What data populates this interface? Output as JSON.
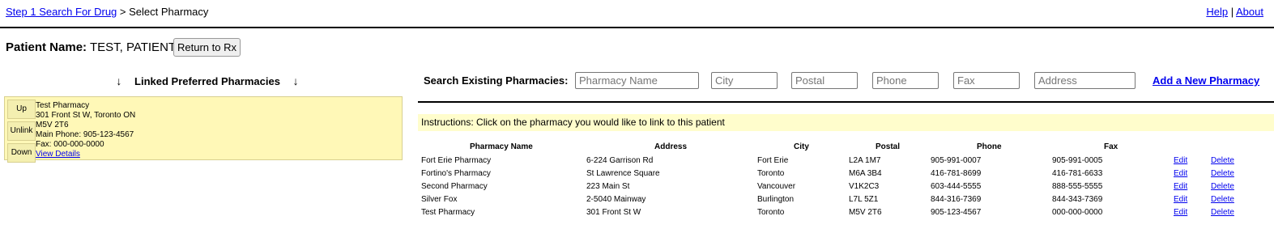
{
  "breadcrumb": {
    "step1_link": "Step 1 Search For Drug",
    "separator": ">",
    "current": "Select Pharmacy"
  },
  "help": {
    "help_link": "Help",
    "separator": "|",
    "about_link": "About"
  },
  "patient": {
    "label": "Patient Name:",
    "name": "TEST, PATIENT",
    "return_button": "Return to Rx"
  },
  "linked": {
    "title": "Linked Preferred Pharmacies",
    "arrow": "↓",
    "card": {
      "buttons": [
        "Up",
        "Unlink",
        "Down"
      ],
      "name": "Test Pharmacy",
      "address": "301 Front St W, Toronto ON",
      "postal": "M5V 2T6",
      "main_phone": "Main Phone: 905-123-4567",
      "fax": "Fax: 000-000-0000",
      "details_link": "View Details"
    }
  },
  "search": {
    "label": "Search Existing Pharmacies:",
    "placeholders": [
      "Pharmacy Name",
      "City",
      "Postal",
      "Phone",
      "Fax",
      "Address"
    ],
    "add_link": "Add a New Pharmacy"
  },
  "instructions": "Instructions: Click on the pharmacy you would like to link to this patient",
  "table": {
    "headers": [
      "Pharmacy Name",
      "Address",
      "City",
      "Postal",
      "Phone",
      "Fax"
    ],
    "rows": [
      [
        "Fort Erie Pharmacy",
        "6-224 Garrison Rd",
        "Fort Erie",
        "L2A 1M7",
        "905-991-0007",
        "905-991-0005"
      ],
      [
        "Fortino's Pharmacy",
        "St Lawrence Square",
        "Toronto",
        "M6A 3B4",
        "416-781-8699",
        "416-781-6633"
      ],
      [
        "Second Pharmacy",
        "223 Main St",
        "Vancouver",
        "V1K2C3",
        "603-444-5555",
        "888-555-5555"
      ],
      [
        "Silver Fox",
        "2-5040 Mainway",
        "Burlington",
        "L7L 5Z1",
        "844-316-7369",
        "844-343-7369"
      ],
      [
        "Test Pharmacy",
        "301 Front St W",
        "Toronto",
        "M5V 2T6",
        "905-123-4567",
        "000-000-0000"
      ]
    ],
    "edit_label": "Edit",
    "delete_label": "Delete"
  }
}
